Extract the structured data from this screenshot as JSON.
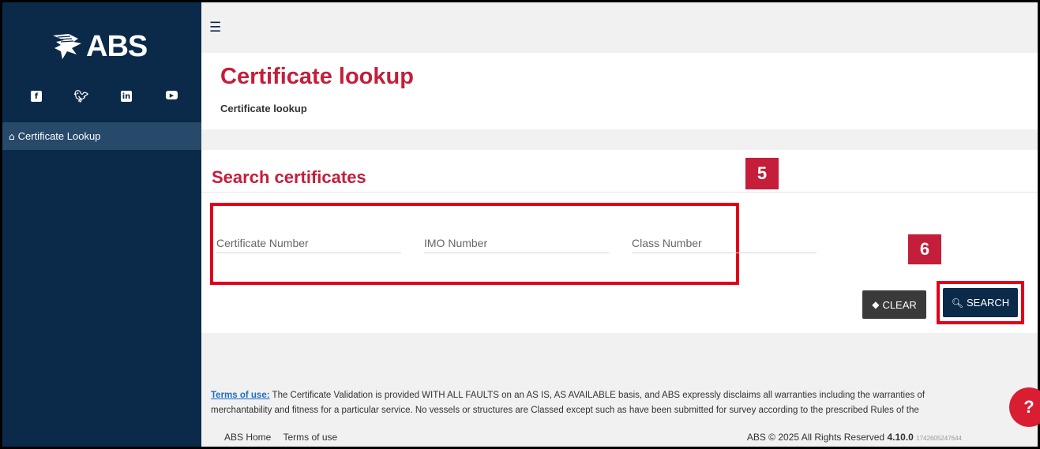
{
  "brand": {
    "name": "ABS"
  },
  "social": [
    "facebook-icon",
    "twitter-icon",
    "linkedin-icon",
    "youtube-icon"
  ],
  "nav": {
    "items": [
      {
        "label": "Certificate Lookup",
        "icon": "home-icon"
      }
    ]
  },
  "page": {
    "title": "Certificate lookup",
    "breadcrumb": "Certificate lookup"
  },
  "search": {
    "title": "Search certificates",
    "fields": {
      "certificate_placeholder": "Certificate Number",
      "imo_placeholder": "IMO Number",
      "class_placeholder": "Class Number"
    },
    "clear_label": "CLEAR",
    "search_label": "SEARCH"
  },
  "annotations": {
    "step5": "5",
    "step6": "6"
  },
  "footer": {
    "terms_link": "Terms of use:",
    "terms_line1": " The Certificate Validation is provided WITH ALL FAULTS on an AS IS, AS AVAILABLE basis, and ABS expressly disclaims all warranties including the warranties of",
    "terms_line2": "merchantability and fitness for a particular service. No vessels or structures are Classed except such as have been submitted for survey according to the prescribed Rules of the",
    "home_link": "ABS Home",
    "terms_nav": "Terms of use",
    "copyright": "ABS © 2025 All Rights Reserved",
    "version": "4.10.0",
    "build": "1742605247644"
  },
  "help": {
    "label": "?"
  },
  "colors": {
    "brand_navy": "#0b2a4a",
    "accent_red": "#c41e3a",
    "highlight_red": "#e1001a"
  }
}
